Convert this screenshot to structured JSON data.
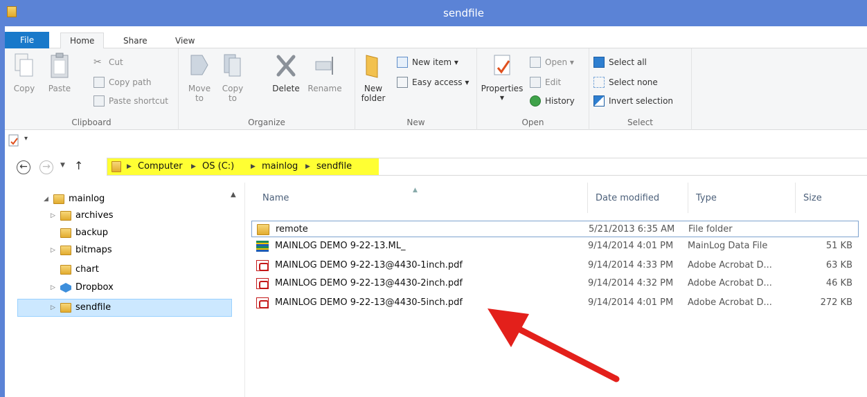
{
  "window": {
    "title": "sendfile"
  },
  "tabs": [
    "File",
    "Home",
    "Share",
    "View"
  ],
  "ribbon": {
    "clipboard": {
      "label": "Clipboard",
      "copy": "Copy",
      "paste": "Paste",
      "cut": "Cut",
      "copy_path": "Copy path",
      "paste_shortcut": "Paste shortcut"
    },
    "organize": {
      "label": "Organize",
      "move_to": "Move to",
      "copy_to": "Copy to",
      "delete": "Delete",
      "rename": "Rename"
    },
    "new": {
      "label": "New",
      "new_folder_line1": "New",
      "new_folder_line2": "folder",
      "new_item": "New item ▾",
      "easy_access": "Easy access ▾"
    },
    "open": {
      "label": "Open",
      "properties": "Properties",
      "open": "Open ▾",
      "edit": "Edit",
      "history": "History"
    },
    "select": {
      "label": "Select",
      "select_all": "Select all",
      "select_none": "Select none",
      "invert_selection": "Invert selection"
    }
  },
  "address": {
    "breadcrumbs": [
      "Computer",
      "OS (C:)",
      "mainlog",
      "sendfile"
    ]
  },
  "navpane": {
    "items": [
      {
        "label": "mainlog",
        "expander": "◢"
      },
      {
        "label": "archives",
        "expander": "▷"
      },
      {
        "label": "backup",
        "expander": ""
      },
      {
        "label": "bitmaps",
        "expander": "▷"
      },
      {
        "label": "chart",
        "expander": ""
      },
      {
        "label": "Dropbox",
        "expander": "▷"
      },
      {
        "label": "sendfile",
        "expander": "▷"
      }
    ]
  },
  "filelist": {
    "columns": [
      "Name",
      "Date modified",
      "Type",
      "Size"
    ],
    "rows": [
      {
        "name": "remote",
        "date": "5/21/2013 6:35 AM",
        "type": "File folder",
        "size": "",
        "icon": "folder-icon"
      },
      {
        "name": "MAINLOG DEMO 9-22-13.ML_",
        "date": "9/14/2014 4:01 PM",
        "type": "MainLog Data File",
        "size": "51 KB",
        "icon": "mainlog-file-icon"
      },
      {
        "name": "MAINLOG DEMO 9-22-13@4430-1inch.pdf",
        "date": "9/14/2014 4:33 PM",
        "type": "Adobe Acrobat D...",
        "size": "63 KB",
        "icon": "pdf-icon"
      },
      {
        "name": "MAINLOG DEMO 9-22-13@4430-2inch.pdf",
        "date": "9/14/2014 4:32 PM",
        "type": "Adobe Acrobat D...",
        "size": "46 KB",
        "icon": "pdf-icon"
      },
      {
        "name": "MAINLOG DEMO 9-22-13@4430-5inch.pdf",
        "date": "9/14/2014 4:01 PM",
        "type": "Adobe Acrobat D...",
        "size": "272 KB",
        "icon": "pdf-icon"
      }
    ]
  },
  "colors": {
    "titlebar": "#5b83d6",
    "file_tab": "#1979ca",
    "address_highlight": "#ffff33",
    "selection": "#cce8ff",
    "annotation_arrow": "#e3201b"
  }
}
